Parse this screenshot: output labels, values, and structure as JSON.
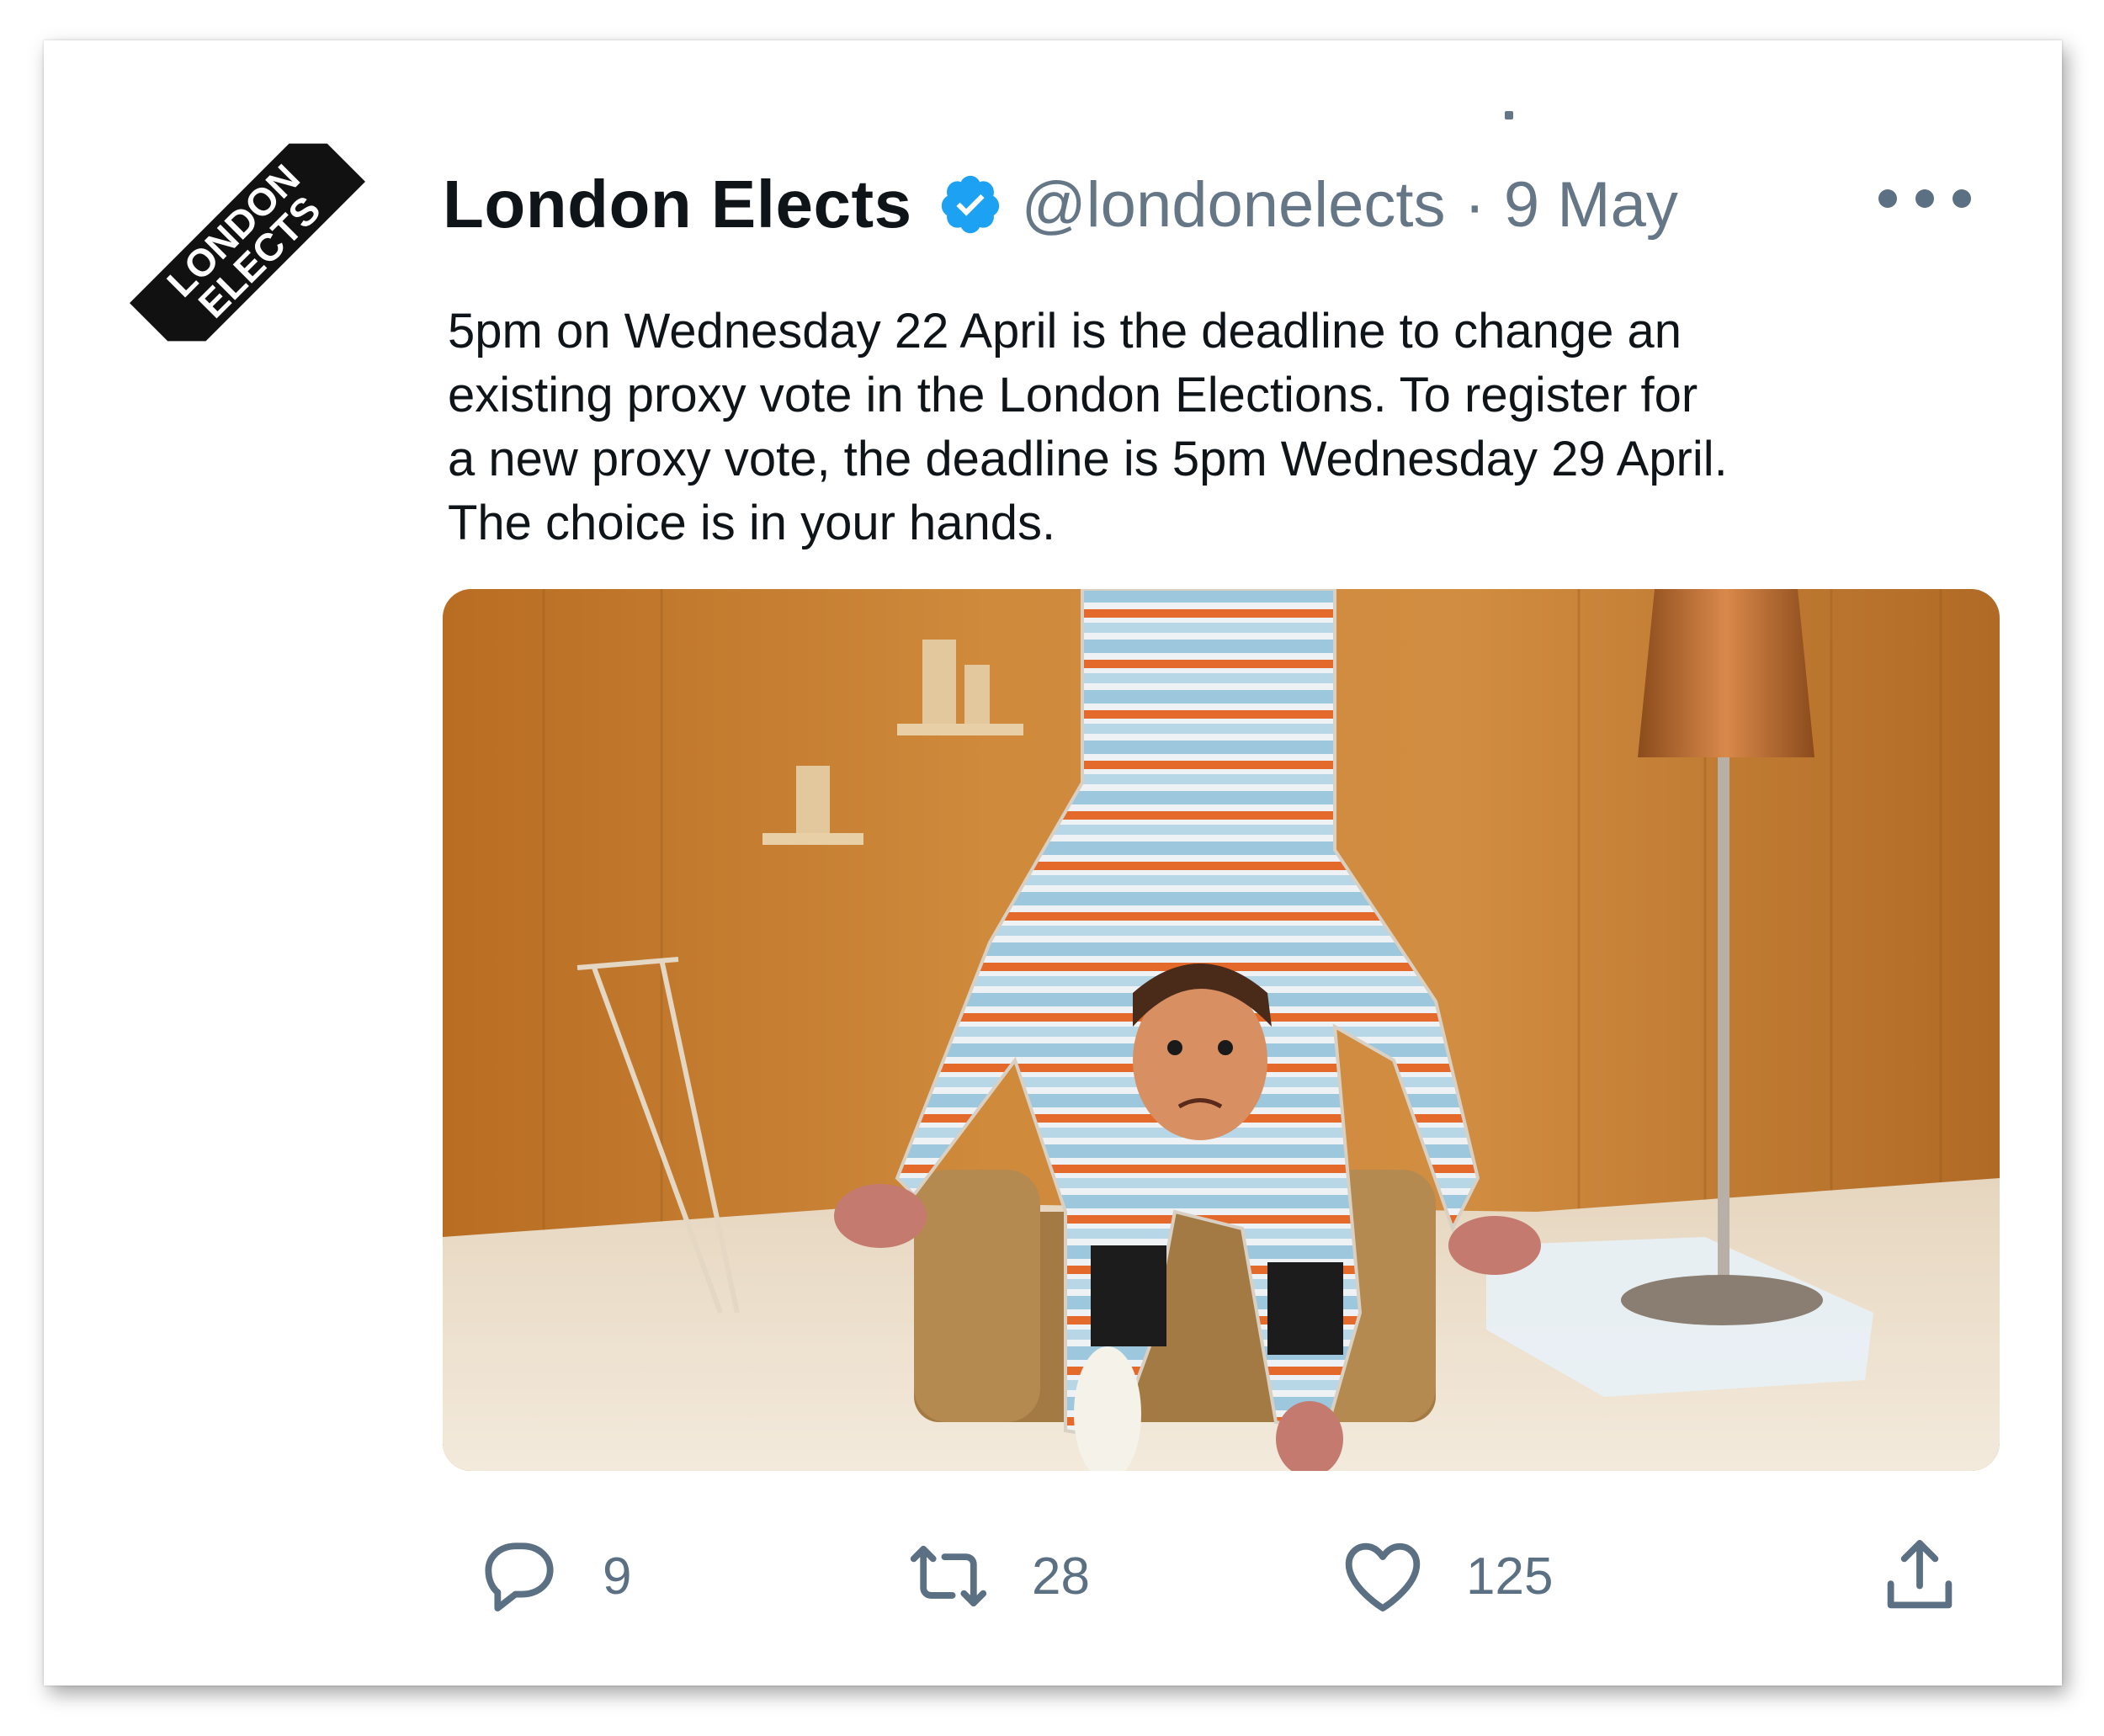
{
  "tweet": {
    "author_name": "London Elects",
    "handle": "@londonelects",
    "separator": "·",
    "date": "9 May",
    "logo_text": [
      "LONDON",
      "ELECTS"
    ],
    "text_lines": [
      "5pm on Wednesday 22 April is the deadline to change an",
      "existing proxy vote in the London Elections. To register for",
      "a new proxy vote, the deadline is 5pm Wednesday 29 April.",
      "The choice is in your hands."
    ],
    "icons": {
      "verified": "verified-badge-icon",
      "more": "more-options-icon",
      "reply": "reply-icon",
      "retweet": "retweet-icon",
      "like": "like-icon",
      "share": "share-icon"
    },
    "stats": {
      "replies": "9",
      "retweets": "28",
      "likes": "125"
    }
  },
  "colors": {
    "text": "#0f1419",
    "secondary": "#657786",
    "verified": "#1da1f2",
    "icon": "#5b7083"
  }
}
